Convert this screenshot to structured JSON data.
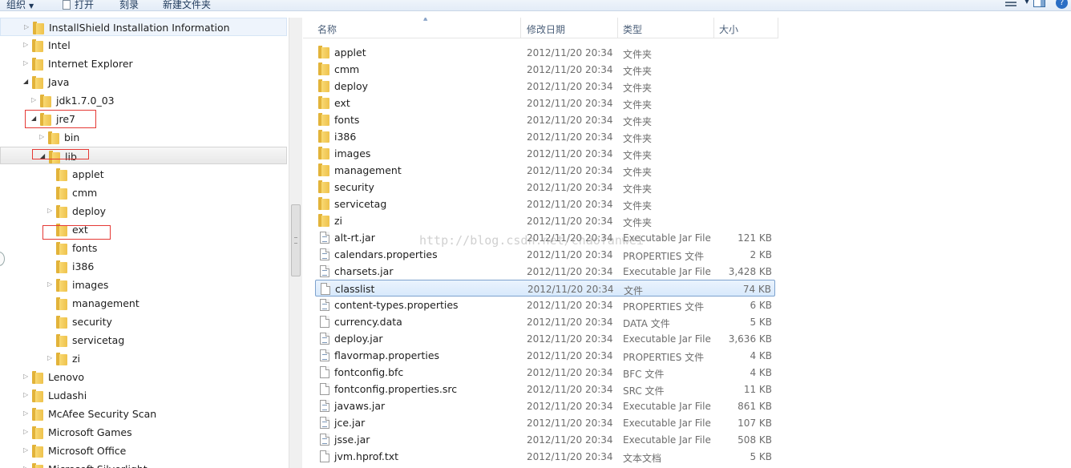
{
  "toolbar": {
    "organize": "组织",
    "open": "打开",
    "burn": "刻录",
    "new_folder": "新建文件夹"
  },
  "nav_tree": [
    {
      "label": "InstallShield Installation Information",
      "expander": "▷",
      "level": 0
    },
    {
      "label": "Intel",
      "expander": "▷",
      "level": 0
    },
    {
      "label": "Internet Explorer",
      "expander": "▷",
      "level": 0
    },
    {
      "label": "Java",
      "expander": "◢",
      "level": 0
    },
    {
      "label": "jdk1.7.0_03",
      "expander": "▷",
      "level": 1
    },
    {
      "label": "jre7",
      "expander": "◢",
      "level": 1
    },
    {
      "label": "bin",
      "expander": "▷",
      "level": 2
    },
    {
      "label": "lib",
      "expander": "◢",
      "level": 2
    },
    {
      "label": "applet",
      "expander": "",
      "level": 3
    },
    {
      "label": "cmm",
      "expander": "",
      "level": 3
    },
    {
      "label": "deploy",
      "expander": "▷",
      "level": 3
    },
    {
      "label": "ext",
      "expander": "",
      "level": 3
    },
    {
      "label": "fonts",
      "expander": "",
      "level": 3
    },
    {
      "label": "i386",
      "expander": "",
      "level": 3
    },
    {
      "label": "images",
      "expander": "▷",
      "level": 3
    },
    {
      "label": "management",
      "expander": "",
      "level": 3
    },
    {
      "label": "security",
      "expander": "",
      "level": 3
    },
    {
      "label": "servicetag",
      "expander": "",
      "level": 3
    },
    {
      "label": "zi",
      "expander": "▷",
      "level": 3
    },
    {
      "label": "Lenovo",
      "expander": "▷",
      "level": 0
    },
    {
      "label": "Ludashi",
      "expander": "▷",
      "level": 0
    },
    {
      "label": "McAfee Security Scan",
      "expander": "▷",
      "level": 0
    },
    {
      "label": "Microsoft Games",
      "expander": "▷",
      "level": 0
    },
    {
      "label": "Microsoft Office",
      "expander": "▷",
      "level": 0
    },
    {
      "label": "Microsoft Silverlight",
      "expander": "▷",
      "level": 0
    }
  ],
  "columns": {
    "name": "名称",
    "date": "修改日期",
    "type": "类型",
    "size": "大小"
  },
  "files": [
    {
      "name": "applet",
      "date": "2012/11/20 20:34",
      "type": "文件夹",
      "size": "",
      "icon": "folder"
    },
    {
      "name": "cmm",
      "date": "2012/11/20 20:34",
      "type": "文件夹",
      "size": "",
      "icon": "folder"
    },
    {
      "name": "deploy",
      "date": "2012/11/20 20:34",
      "type": "文件夹",
      "size": "",
      "icon": "folder"
    },
    {
      "name": "ext",
      "date": "2012/11/20 20:34",
      "type": "文件夹",
      "size": "",
      "icon": "folder"
    },
    {
      "name": "fonts",
      "date": "2012/11/20 20:34",
      "type": "文件夹",
      "size": "",
      "icon": "folder"
    },
    {
      "name": "i386",
      "date": "2012/11/20 20:34",
      "type": "文件夹",
      "size": "",
      "icon": "folder"
    },
    {
      "name": "images",
      "date": "2012/11/20 20:34",
      "type": "文件夹",
      "size": "",
      "icon": "folder"
    },
    {
      "name": "management",
      "date": "2012/11/20 20:34",
      "type": "文件夹",
      "size": "",
      "icon": "folder"
    },
    {
      "name": "security",
      "date": "2012/11/20 20:34",
      "type": "文件夹",
      "size": "",
      "icon": "folder"
    },
    {
      "name": "servicetag",
      "date": "2012/11/20 20:34",
      "type": "文件夹",
      "size": "",
      "icon": "folder"
    },
    {
      "name": "zi",
      "date": "2012/11/20 20:34",
      "type": "文件夹",
      "size": "",
      "icon": "folder"
    },
    {
      "name": "alt-rt.jar",
      "date": "2012/11/20 20:34",
      "type": "Executable Jar File",
      "size": "121 KB",
      "icon": "jar-file"
    },
    {
      "name": "calendars.properties",
      "date": "2012/11/20 20:34",
      "type": "PROPERTIES 文件",
      "size": "2 KB",
      "icon": "properties-file"
    },
    {
      "name": "charsets.jar",
      "date": "2012/11/20 20:34",
      "type": "Executable Jar File",
      "size": "3,428 KB",
      "icon": "jar-file"
    },
    {
      "name": "classlist",
      "date": "2012/11/20 20:34",
      "type": "文件",
      "size": "74 KB",
      "icon": "file"
    },
    {
      "name": "content-types.properties",
      "date": "2012/11/20 20:34",
      "type": "PROPERTIES 文件",
      "size": "6 KB",
      "icon": "properties-file"
    },
    {
      "name": "currency.data",
      "date": "2012/11/20 20:34",
      "type": "DATA 文件",
      "size": "5 KB",
      "icon": "file"
    },
    {
      "name": "deploy.jar",
      "date": "2012/11/20 20:34",
      "type": "Executable Jar File",
      "size": "3,636 KB",
      "icon": "jar-file"
    },
    {
      "name": "flavormap.properties",
      "date": "2012/11/20 20:34",
      "type": "PROPERTIES 文件",
      "size": "4 KB",
      "icon": "properties-file"
    },
    {
      "name": "fontconfig.bfc",
      "date": "2012/11/20 20:34",
      "type": "BFC 文件",
      "size": "4 KB",
      "icon": "file"
    },
    {
      "name": "fontconfig.properties.src",
      "date": "2012/11/20 20:34",
      "type": "SRC 文件",
      "size": "11 KB",
      "icon": "file"
    },
    {
      "name": "javaws.jar",
      "date": "2012/11/20 20:34",
      "type": "Executable Jar File",
      "size": "861 KB",
      "icon": "jar-file"
    },
    {
      "name": "jce.jar",
      "date": "2012/11/20 20:34",
      "type": "Executable Jar File",
      "size": "107 KB",
      "icon": "jar-file"
    },
    {
      "name": "jsse.jar",
      "date": "2012/11/20 20:34",
      "type": "Executable Jar File",
      "size": "508 KB",
      "icon": "jar-file"
    },
    {
      "name": "jvm.hprof.txt",
      "date": "2012/11/20 20:34",
      "type": "文本文档",
      "size": "5 KB",
      "icon": "text-file"
    }
  ],
  "selected_file": "classlist",
  "watermark": "http://blog.csdn.net/chaofanwei"
}
